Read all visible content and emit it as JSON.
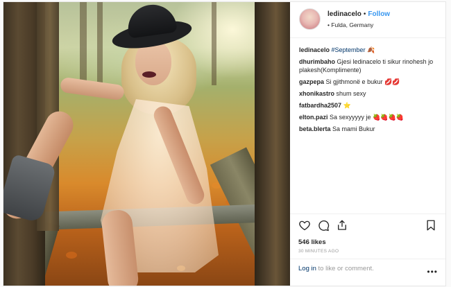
{
  "post": {
    "username": "ledinacelo",
    "separator": "•",
    "follow_label": "Follow",
    "location_prefix": "•",
    "location": "Fulda, Germany"
  },
  "caption": {
    "user": "ledinacelo",
    "hashtag": "#September",
    "emoji": "🍂"
  },
  "comments": [
    {
      "user": "dhurimbaho",
      "text": "Gjesi ledinacelo ti sikur rinohesh jo plakesh(Komplimente)"
    },
    {
      "user": "gazpepa",
      "text": "Si gjithmonë e bukur",
      "emoji": "💋💋"
    },
    {
      "user": "xhonikastro",
      "text": "shum sexy"
    },
    {
      "user": "fatbardha2507",
      "text": "",
      "emoji": "⭐"
    },
    {
      "user": "elton.pazi",
      "text": "Sa sexyyyyy je",
      "emoji": "🍓🍓🍓🍓"
    },
    {
      "user": "beta.blerta",
      "text": "Sa mami Bukur"
    }
  ],
  "actions": {
    "like_icon": "heart-icon",
    "comment_icon": "speech-bubble-icon",
    "share_icon": "share-upload-icon",
    "save_icon": "bookmark-icon"
  },
  "likes": "546 likes",
  "timestamp": "30 MINUTES AGO",
  "comment_bar": {
    "login_label": "Log in",
    "rest_text": " to like or comment.",
    "more_label": "•••"
  },
  "colors": {
    "link_blue": "#3897f0",
    "hashtag_blue": "#003569",
    "muted": "#999999"
  }
}
